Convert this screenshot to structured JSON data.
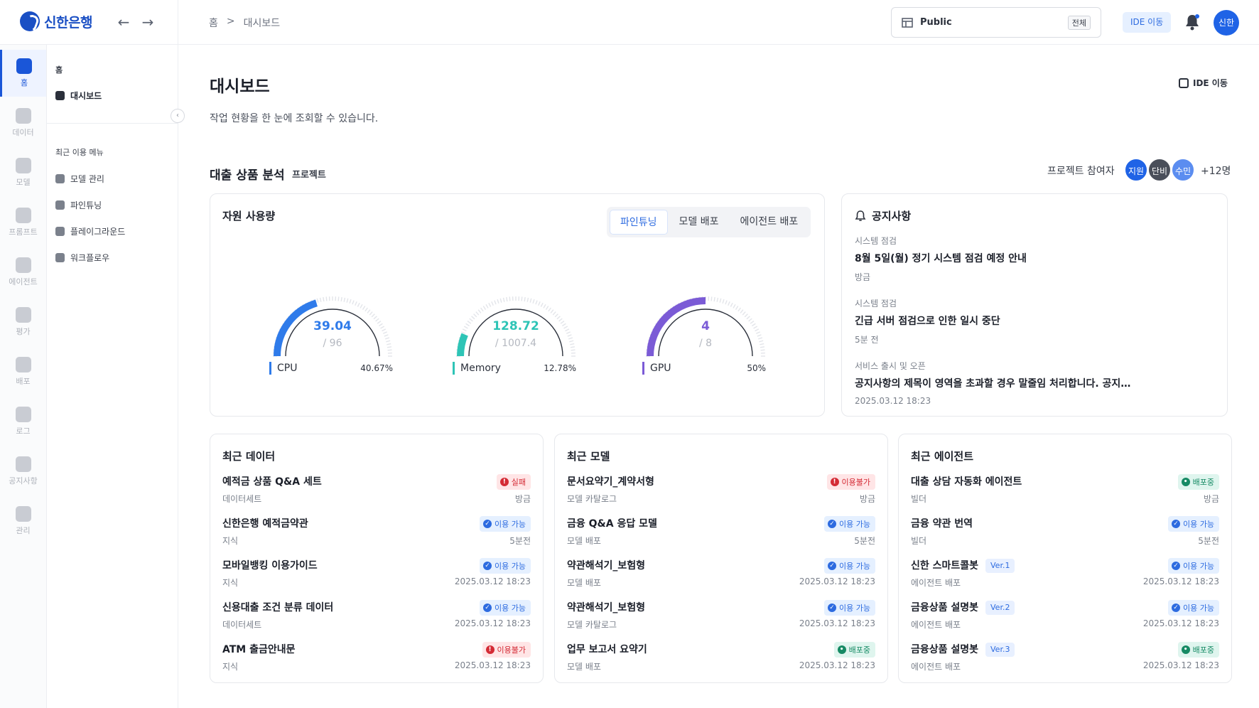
{
  "header": {
    "logo_text": "신한은행",
    "breadcrumb": [
      "홈",
      ">",
      "대시보드"
    ],
    "workspace_name": "Public",
    "workspace_tag": "전체",
    "ide_button": "IDE 이동",
    "user_avatar": "신한"
  },
  "rail": [
    {
      "label": "홈",
      "icon": "home-icon",
      "active": true
    },
    {
      "label": "데이터",
      "icon": "database-icon"
    },
    {
      "label": "모델",
      "icon": "layers-icon"
    },
    {
      "label": "프롬프트",
      "icon": "prompt-icon"
    },
    {
      "label": "에이전트",
      "icon": "chip-icon"
    },
    {
      "label": "평가",
      "icon": "evaluate-icon"
    },
    {
      "label": "배포",
      "icon": "deploy-icon"
    },
    {
      "label": "로그",
      "icon": "log-icon"
    },
    {
      "label": "공지사항",
      "icon": "megaphone-icon"
    },
    {
      "label": "관리",
      "icon": "gear-icon"
    }
  ],
  "subnav": {
    "home_heading": "홈",
    "dashboard_item": "대시보드",
    "recent_heading": "최근 이용 메뉴",
    "recent_items": [
      "모델 관리",
      "파인튜닝",
      "플레이그라운드",
      "워크플로우"
    ]
  },
  "page": {
    "title": "대시보드",
    "description": "작업 현황을 한 눈에 조회할 수 있습니다.",
    "ide_link": "IDE 이동"
  },
  "project": {
    "title": "대출 상품 분석",
    "tag": "프로젝트",
    "participants_label": "프로젝트 참여자",
    "participants": [
      {
        "name": "지원",
        "color": "#1f63e6"
      },
      {
        "name": "단비",
        "color": "#4a4f5a"
      },
      {
        "name": "수민",
        "color": "#5b8df0"
      }
    ],
    "participants_more": "+12명"
  },
  "resources": {
    "title": "자원 사용량",
    "tabs": [
      "파인튜닝",
      "모델 배포",
      "에이전트 배포"
    ],
    "active_tab": 0,
    "gauges": [
      {
        "label": "CPU",
        "value": "39.04",
        "max": "/ 96",
        "percent": "40.67%",
        "fraction": 0.4067,
        "color": "#2f7bea"
      },
      {
        "label": "Memory",
        "value": "128.72",
        "max": "/ 1007.4",
        "percent": "12.78%",
        "fraction": 0.1278,
        "color": "#2ec4b6"
      },
      {
        "label": "GPU",
        "value": "4",
        "max": "/ 8",
        "percent": "50%",
        "fraction": 0.5,
        "color": "#7b5bd6"
      }
    ]
  },
  "notices": {
    "title": "공지사항",
    "items": [
      {
        "category": "시스템 점검",
        "title": "8월 5일(월) 정기 시스템 점검 예정 안내",
        "time": "방금"
      },
      {
        "category": "시스템 점검",
        "title": "긴급 서버 점검으로 인한 일시 중단",
        "time": "5분 전"
      },
      {
        "category": "서비스 출시 및 오픈",
        "title": "공지사항의 제목이 영역을 초과할 경우 말줄임 처리합니다. 공지사항의 제목이 영역을 초과할 경우",
        "time": "2025.03.12 18:23"
      }
    ]
  },
  "recent_data": {
    "title": "최근 데이터",
    "rows": [
      {
        "name": "예적금 상품 Q&A 세트",
        "sub": "데이터세트",
        "status": "실패",
        "kind": "fail",
        "time": "방금"
      },
      {
        "name": "신한은행 예적금약관",
        "sub": "지식",
        "status": "이용 가능",
        "kind": "ok",
        "time": "5분전"
      },
      {
        "name": "모바일뱅킹 이용가이드",
        "sub": "지식",
        "status": "이용 가능",
        "kind": "ok",
        "time": "2025.03.12 18:23"
      },
      {
        "name": "신용대출 조건 분류 데이터",
        "sub": "데이터세트",
        "status": "이용 가능",
        "kind": "ok",
        "time": "2025.03.12 18:23"
      },
      {
        "name": "ATM 출금안내문",
        "sub": "지식",
        "status": "이용불가",
        "kind": "fail",
        "time": "2025.03.12 18:23"
      }
    ]
  },
  "recent_models": {
    "title": "최근 모델",
    "rows": [
      {
        "name": "문서요약기_계약서형",
        "sub": "모델 카탈로그",
        "status": "이용불가",
        "kind": "fail",
        "time": "방금"
      },
      {
        "name": "금융 Q&A 응답 모델",
        "sub": "모델 배포",
        "status": "이용 가능",
        "kind": "ok",
        "time": "5분전"
      },
      {
        "name": "약관해석기_보험형",
        "sub": "모델 배포",
        "status": "이용 가능",
        "kind": "ok",
        "time": "2025.03.12 18:23"
      },
      {
        "name": "약관해석기_보험형",
        "sub": "모델 카탈로그",
        "status": "이용 가능",
        "kind": "ok",
        "time": "2025.03.12 18:23"
      },
      {
        "name": "업무 보고서 요약기",
        "sub": "모델 배포",
        "status": "배포중",
        "kind": "deploy",
        "time": "2025.03.12 18:23"
      }
    ]
  },
  "recent_agents": {
    "title": "최근 에이전트",
    "rows": [
      {
        "name": "대출 상담 자동화 에이전트",
        "sub": "빌더",
        "status": "배포중",
        "kind": "deploy",
        "time": "방금",
        "version": ""
      },
      {
        "name": "금융 약관 번역",
        "sub": "빌더",
        "status": "이용 가능",
        "kind": "ok",
        "time": "5분전",
        "version": ""
      },
      {
        "name": "신한 스마트콜봇",
        "sub": "에이전트 배포",
        "status": "이용 가능",
        "kind": "ok",
        "time": "2025.03.12 18:23",
        "version": "Ver.1"
      },
      {
        "name": "금융상품 설명봇",
        "sub": "에이전트 배포",
        "status": "이용 가능",
        "kind": "ok",
        "time": "2025.03.12 18:23",
        "version": "Ver.2"
      },
      {
        "name": "금융상품 설명봇",
        "sub": "에이전트 배포",
        "status": "배포중",
        "kind": "deploy",
        "time": "2025.03.12 18:23",
        "version": "Ver.3"
      }
    ]
  }
}
